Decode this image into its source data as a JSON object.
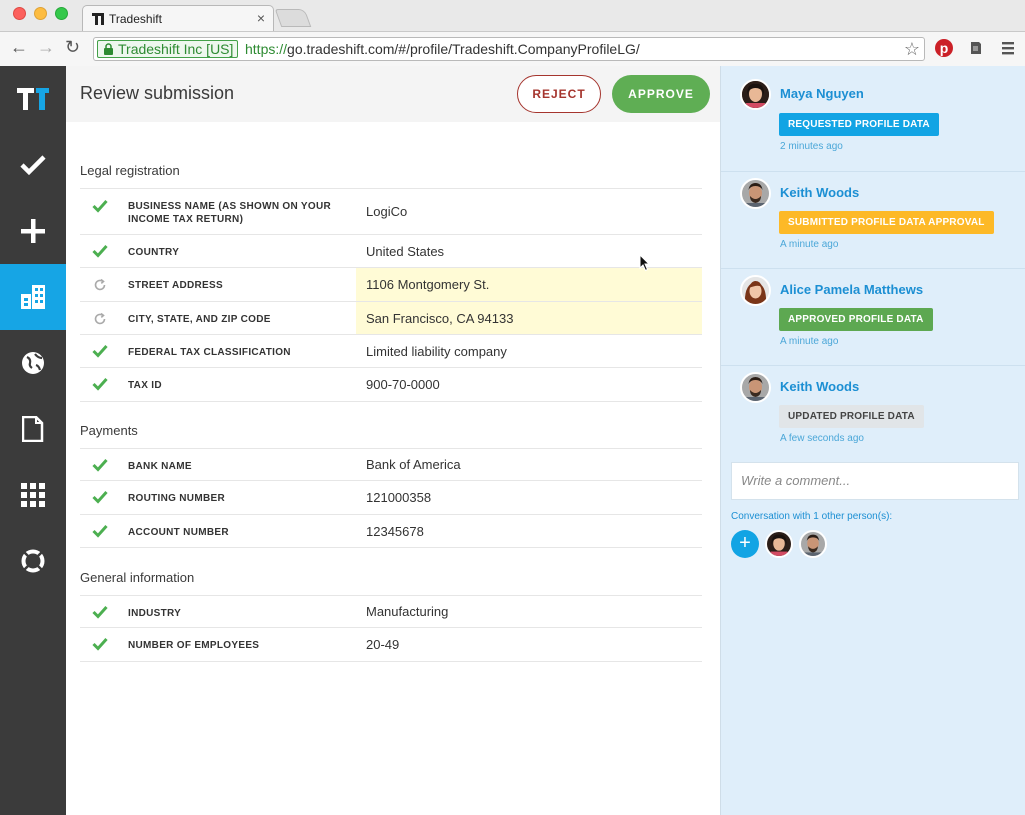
{
  "browser": {
    "tab_title": "Tradeshift",
    "tab_close": "×",
    "ev_label": "Tradeshift Inc [US]",
    "url_scheme": "https://",
    "url_rest": "go.tradeshift.com/#/profile/Tradeshift.CompanyProfileLG/"
  },
  "header": {
    "title": "Review submission",
    "reject_label": "REJECT",
    "approve_label": "APPROVE"
  },
  "sections": [
    {
      "title": "Legal registration",
      "rows": [
        {
          "label": "BUSINESS NAME (AS SHOWN ON YOUR INCOME TAX RETURN)",
          "value": "LogiCo",
          "status": "approved"
        },
        {
          "label": "COUNTRY",
          "value": "United States",
          "status": "approved"
        },
        {
          "label": "STREET ADDRESS",
          "value": "1106 Montgomery St.",
          "status": "pending"
        },
        {
          "label": "CITY, STATE, AND ZIP CODE",
          "value": "San Francisco, CA 94133",
          "status": "pending"
        },
        {
          "label": "FEDERAL TAX CLASSIFICATION",
          "value": "Limited liability company",
          "status": "approved"
        },
        {
          "label": "TAX ID",
          "value": "900-70-0000",
          "status": "approved"
        }
      ]
    },
    {
      "title": "Payments",
      "rows": [
        {
          "label": "BANK NAME",
          "value": "Bank of America",
          "status": "approved"
        },
        {
          "label": "ROUTING NUMBER",
          "value": "121000358",
          "status": "approved"
        },
        {
          "label": "ACCOUNT NUMBER",
          "value": "12345678",
          "status": "approved"
        }
      ]
    },
    {
      "title": "General information",
      "rows": [
        {
          "label": "INDUSTRY",
          "value": "Manufacturing",
          "status": "approved"
        },
        {
          "label": "NUMBER OF EMPLOYEES",
          "value": "20-49",
          "status": "approved"
        }
      ]
    }
  ],
  "activity": [
    {
      "name": "Maya Nguyen",
      "badge": "REQUESTED PROFILE DATA",
      "badge_color": "#12a4e4",
      "time": "2 minutes ago"
    },
    {
      "name": "Keith Woods",
      "badge": "SUBMITTED PROFILE DATA APPROVAL",
      "badge_color": "#fdb927",
      "time": "A minute ago"
    },
    {
      "name": "Alice Pamela Matthews",
      "badge": "APPROVED PROFILE DATA",
      "badge_color": "#5da851",
      "time": "A minute ago"
    },
    {
      "name": "Keith Woods",
      "badge": "UPDATED PROFILE DATA",
      "badge_color": "#e1e5e8",
      "time": "A few seconds ago"
    }
  ],
  "comment_placeholder": "Write a comment...",
  "conversation_text": "Conversation with 1 other person(s):",
  "add_label": "+",
  "colors": {
    "nav_bg": "#3b3b3b",
    "nav_active": "#16a5e5",
    "approve": "#5fae54",
    "reject": "#a5352e",
    "link": "#1c8fd3",
    "panel_bg": "#dfeefa",
    "highlight": "#fffbd6"
  },
  "nav_icons": [
    "tradeshift-logo-icon",
    "check-icon",
    "plus-icon",
    "company-icon",
    "globe-icon",
    "document-icon",
    "apps-grid-icon",
    "lifebuoy-icon"
  ]
}
